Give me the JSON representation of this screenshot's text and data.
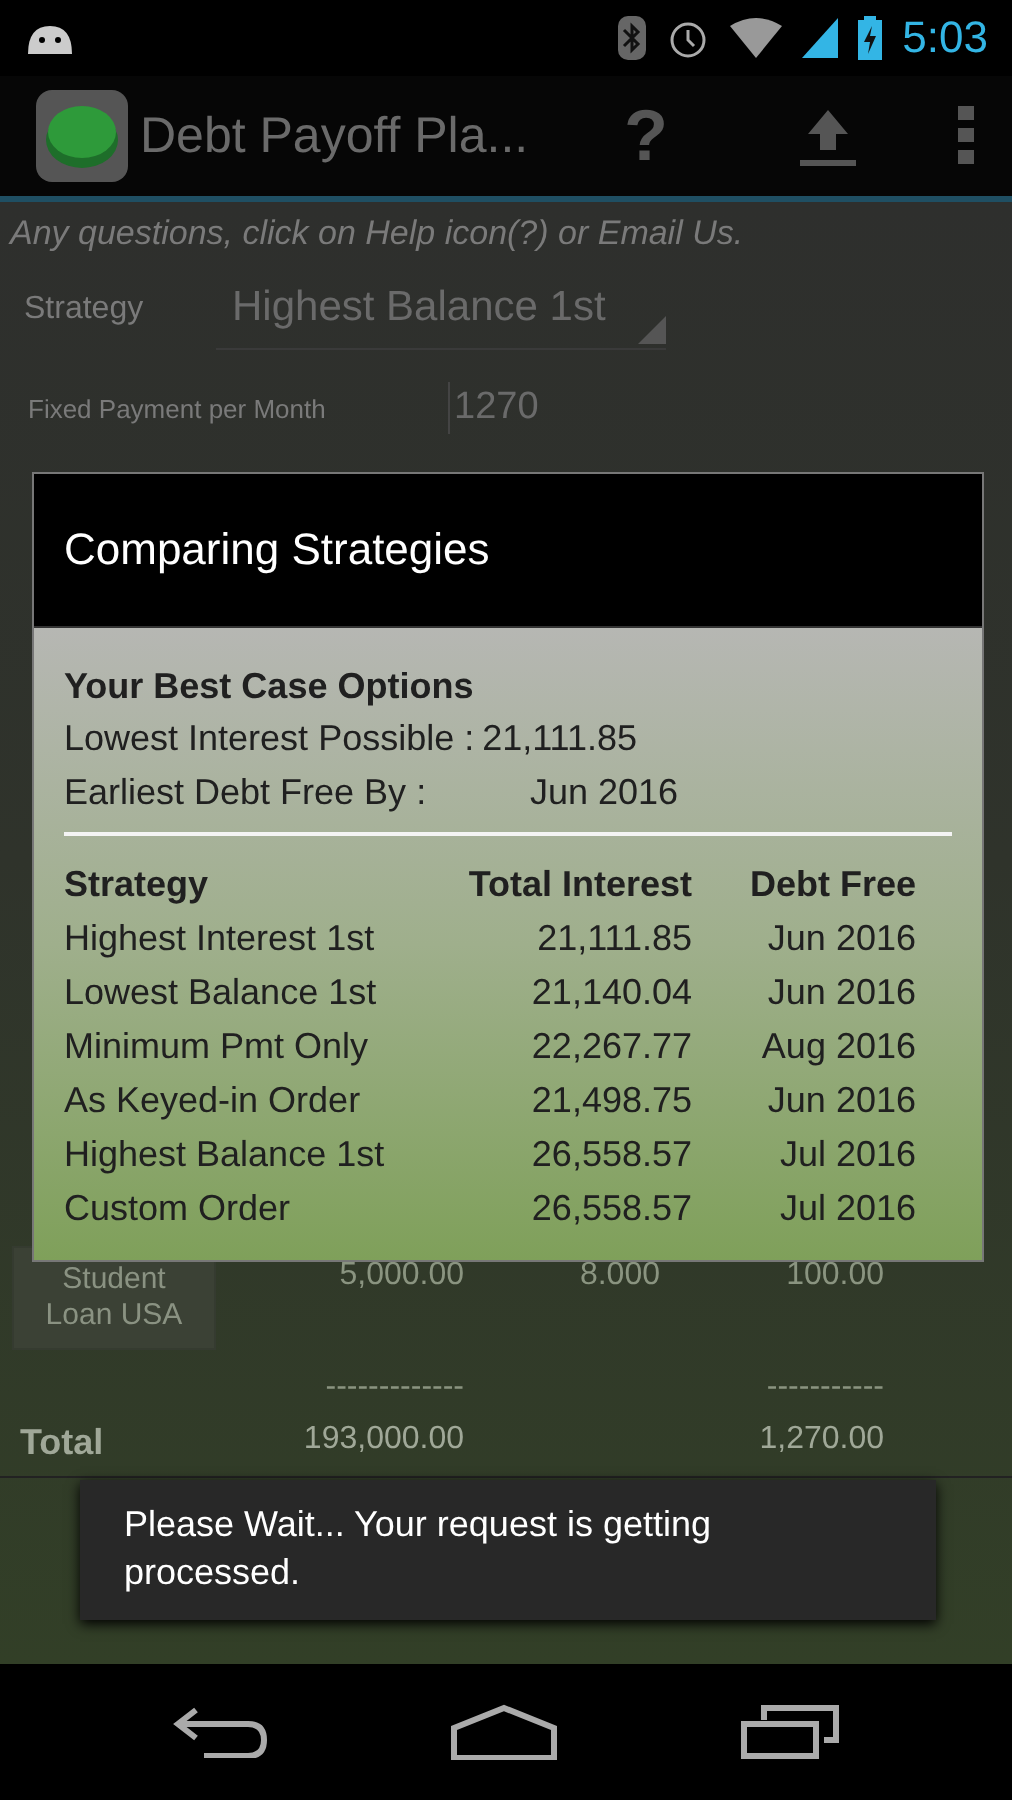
{
  "status_bar": {
    "time": "5:03"
  },
  "action_bar": {
    "title": "Debt Payoff Pla...",
    "help": "?"
  },
  "screen": {
    "hint": "Any questions, click on Help icon(?) or Email Us.",
    "strategy_label": "Strategy",
    "strategy_value": "Highest Balance 1st",
    "payment_label": "Fixed Payment per Month",
    "payment_value": "1270",
    "debt_row": {
      "name": "Student Loan USA",
      "balance": "5,000.00",
      "rate": "8.000",
      "payment": "100.00"
    },
    "separators": [
      "-------------",
      "-----------"
    ],
    "total": {
      "label": "Total",
      "balance": "193,000.00",
      "payment": "1,270.00"
    }
  },
  "dialog": {
    "title": "Comparing Strategies",
    "best_heading": "Your Best Case Options",
    "best": [
      {
        "label": "Lowest Interest Possible :",
        "value": "21,111.85"
      },
      {
        "label": "Earliest Debt Free By :",
        "value": "Jun 2016"
      }
    ],
    "columns": [
      "Strategy",
      "Total Interest",
      "Debt Free"
    ],
    "rows": [
      [
        "Highest Interest 1st",
        "21,111.85",
        "Jun 2016"
      ],
      [
        "Lowest Balance 1st",
        "21,140.04",
        "Jun 2016"
      ],
      [
        "Minimum Pmt Only",
        "22,267.77",
        "Aug 2016"
      ],
      [
        "As Keyed-in Order",
        "21,498.75",
        "Jun 2016"
      ],
      [
        "Highest Balance 1st",
        "26,558.57",
        "Jul 2016"
      ],
      [
        "Custom Order",
        "26,558.57",
        "Jul 2016"
      ]
    ]
  },
  "toast": {
    "message": "Please Wait... Your request is getting processed."
  }
}
